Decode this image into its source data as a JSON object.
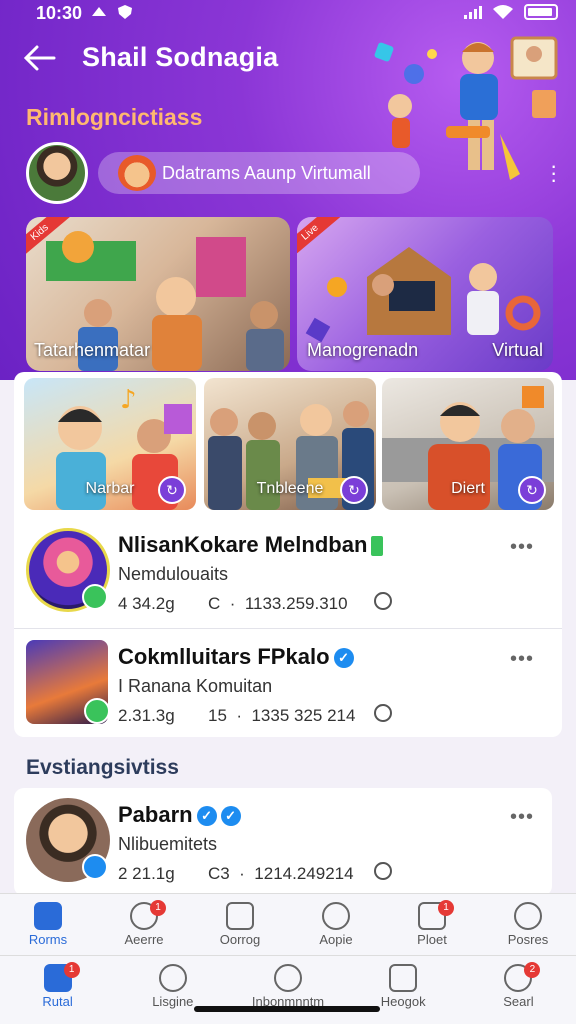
{
  "status": {
    "time": "10:30"
  },
  "header": {
    "title": "Shail Sodnagia",
    "back_icon": "arrow-left-icon"
  },
  "section_heading": "Rimlogncictiass",
  "profile_pill": {
    "text": "Ddatrams Aaunp Virtumall"
  },
  "feature_cards": [
    {
      "label": "Tatarhenmatar",
      "ribbon": "Kids"
    },
    {
      "label": "Manogrenadn",
      "label2": "Virtual",
      "ribbon": "Live"
    }
  ],
  "thumbs": [
    {
      "label": "Narbar"
    },
    {
      "label": "Tnbleene"
    },
    {
      "label": "Diert"
    }
  ],
  "items": [
    {
      "name": "NlisanKokare Melndban",
      "sub": "Nemdulouaits",
      "meta_left": "4 34.2g",
      "meta_right": "C  ·  1133.259.310"
    },
    {
      "name": "Cokmlluitars FPkalo",
      "sub": "I Ranana Komuitan",
      "meta_left": "2.31.3g",
      "meta_right": "15  ·  1335 325 214"
    },
    {
      "name": "Pabarn",
      "sub": "Nlibuemitets",
      "meta_left": "2 21.1g",
      "meta_right": "C3  ·  1214.249214"
    }
  ],
  "section_heading_2": "Evstiangsivtiss",
  "nav_top": [
    {
      "label": "Rorms",
      "icon": "home-icon",
      "active": true
    },
    {
      "label": "Aeerre",
      "icon": "clock-icon",
      "badge": "1"
    },
    {
      "label": "Oorrog",
      "icon": "grid-icon"
    },
    {
      "label": "Aopie",
      "icon": "smile-icon"
    },
    {
      "label": "Ploet",
      "icon": "calendar-icon",
      "badge": "1"
    },
    {
      "label": "Posres",
      "icon": "user-icon"
    }
  ],
  "nav_bottom": [
    {
      "label": "Rutal",
      "icon": "home-icon",
      "active": true,
      "badge": "1"
    },
    {
      "label": "Lisgine",
      "icon": "chat-icon"
    },
    {
      "label": "Inbonmnntm",
      "icon": "search-icon"
    },
    {
      "label": "Heogok",
      "icon": "box-icon"
    },
    {
      "label": "Searl",
      "icon": "user-icon",
      "badge": "2"
    }
  ],
  "colors": {
    "accent": "#7b3fd8",
    "link": "#2a6bd8",
    "badge": "#e53935"
  }
}
